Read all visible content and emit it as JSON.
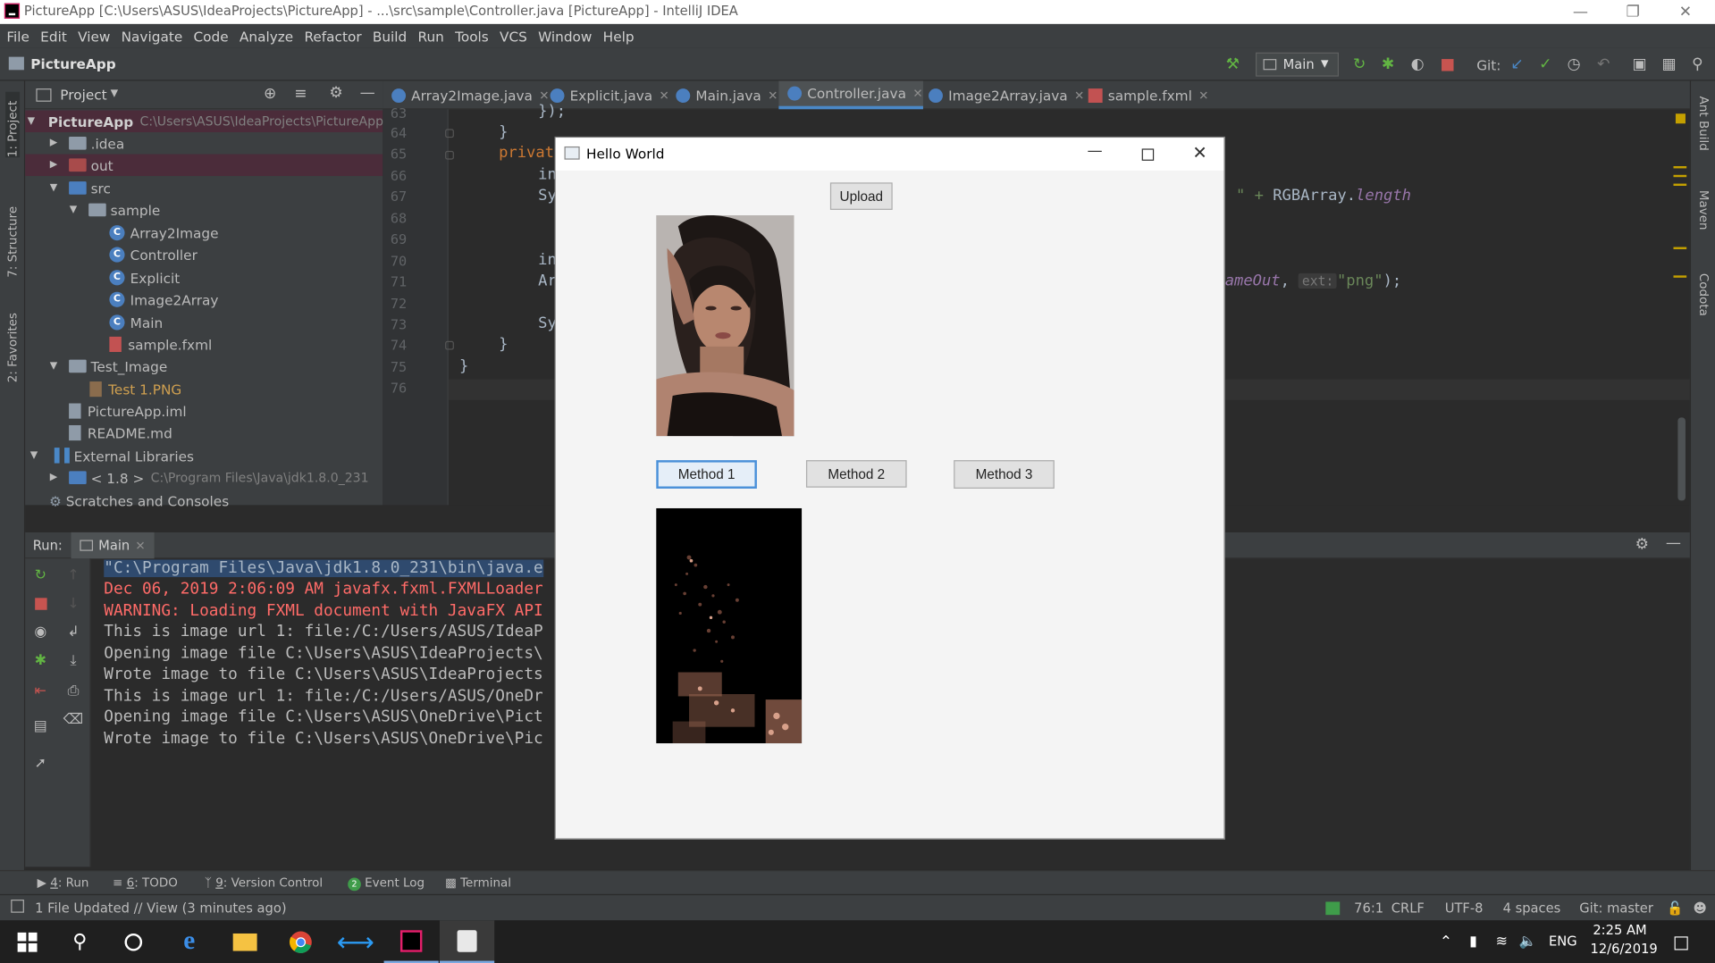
{
  "window": {
    "title": "PictureApp [C:\\Users\\ASUS\\IdeaProjects\\PictureApp] - ...\\src\\sample\\Controller.java [PictureApp] - IntelliJ IDEA"
  },
  "menu": [
    "File",
    "Edit",
    "View",
    "Navigate",
    "Code",
    "Analyze",
    "Refactor",
    "Build",
    "Run",
    "Tools",
    "VCS",
    "Window",
    "Help"
  ],
  "navbar": {
    "project": "PictureApp",
    "run_config": "Main",
    "git_label": "Git:"
  },
  "left_stripe": {
    "project": "1: Project",
    "structure": "7: Structure",
    "favorites": "2: Favorites"
  },
  "right_stripe": {
    "ant": "Ant Build",
    "maven": "Maven",
    "codota": "Codota"
  },
  "project_panel": {
    "title": "Project",
    "tree": [
      {
        "label": "PictureApp",
        "path": "C:\\Users\\ASUS\\IdeaProjects\\PictureApp"
      },
      {
        "label": ".idea"
      },
      {
        "label": "out"
      },
      {
        "label": "src"
      },
      {
        "label": "sample"
      },
      {
        "label": "Array2Image"
      },
      {
        "label": "Controller"
      },
      {
        "label": "Explicit"
      },
      {
        "label": "Image2Array"
      },
      {
        "label": "Main"
      },
      {
        "label": "sample.fxml"
      },
      {
        "label": "Test_Image"
      },
      {
        "label": "Test 1.PNG"
      },
      {
        "label": "PictureApp.iml"
      },
      {
        "label": "README.md"
      },
      {
        "label": "External Libraries"
      },
      {
        "label": "< 1.8 >",
        "path": "C:\\Program Files\\Java\\jdk1.8.0_231"
      },
      {
        "label": "Scratches and Consoles"
      }
    ]
  },
  "editor_tabs": [
    "Array2Image.java",
    "Explicit.java",
    "Main.java",
    "Controller.java",
    "Image2Array.java",
    "sample.fxml"
  ],
  "editor": {
    "line_numbers": [
      "63",
      "64",
      "65",
      "66",
      "67",
      "68",
      "69",
      "70",
      "71",
      "72",
      "73",
      "74",
      "75",
      "76"
    ],
    "code": {
      "l63": "});",
      "l64": "}",
      "l65": "privat",
      "l66": "in",
      "l67": "Sy",
      "l67b_str": "\" + ",
      "l67b_plain": "RGBArray.",
      "l67b_field": "length",
      "l70": "in",
      "l71": "Ar",
      "l71b_it": "ameOut",
      "l71b_comma": ",",
      "l71b_hint": "ext:",
      "l71b_str": "\"png\"",
      "l71b_end": ");",
      "l73": "Sy",
      "l74": "}",
      "l75": "}"
    }
  },
  "run_panel": {
    "label": "Run:",
    "tab": "Main",
    "console": [
      {
        "text": "\"C:\\Program Files\\Java\\jdk1.8.0_231\\bin\\java.e",
        "color": "#a9b7c6"
      },
      {
        "text": "Dec 06, 2019 2:06:09 AM javafx.fxml.FXMLLoader",
        "color": "#ff6b68"
      },
      {
        "text": "WARNING: Loading FXML document with JavaFX API",
        "color": "#ff6b68"
      },
      {
        "text": "This is image url 1: file:/C:/Users/ASUS/IdeaP",
        "color": "#bbbbbb"
      },
      {
        "text": "Opening image file C:\\Users\\ASUS\\IdeaProjects\\",
        "color": "#bbbbbb"
      },
      {
        "text": "Wrote image to file C:\\Users\\ASUS\\IdeaProjects",
        "color": "#bbbbbb"
      },
      {
        "text": "This is image url 1: file:/C:/Users/ASUS/OneDr",
        "color": "#bbbbbb"
      },
      {
        "text": "Opening image file C:\\Users\\ASUS\\OneDrive\\Pict",
        "color": "#bbbbbb"
      },
      {
        "text": "Wrote image to file C:\\Users\\ASUS\\OneDrive\\Pic",
        "color": "#bbbbbb"
      }
    ]
  },
  "bottom_tools": [
    {
      "num": "4",
      "label": ": Run"
    },
    {
      "num": "6",
      "label": ": TODO"
    },
    {
      "num": "9",
      "label": ": Version Control"
    },
    {
      "num": "",
      "label": "Event Log"
    },
    {
      "num": "",
      "label": "Terminal"
    }
  ],
  "status": {
    "message": "1 File Updated // View (3 minutes ago)",
    "position": "76:1",
    "line_sep": "CRLF",
    "encoding": "UTF-8",
    "indent": "4 spaces",
    "git": "Git: master"
  },
  "taskbar": {
    "lang": "ENG",
    "time": "2:25 AM",
    "date": "12/6/2019"
  },
  "dialog": {
    "title": "Hello World",
    "upload": "Upload",
    "method1": "Method 1",
    "method2": "Method 2",
    "method3": "Method 3"
  },
  "colors": {
    "accent": "#4a88c7",
    "editor_bg": "#2b2b2b",
    "panel_bg": "#3c3f41",
    "error": "#ff6b68"
  }
}
